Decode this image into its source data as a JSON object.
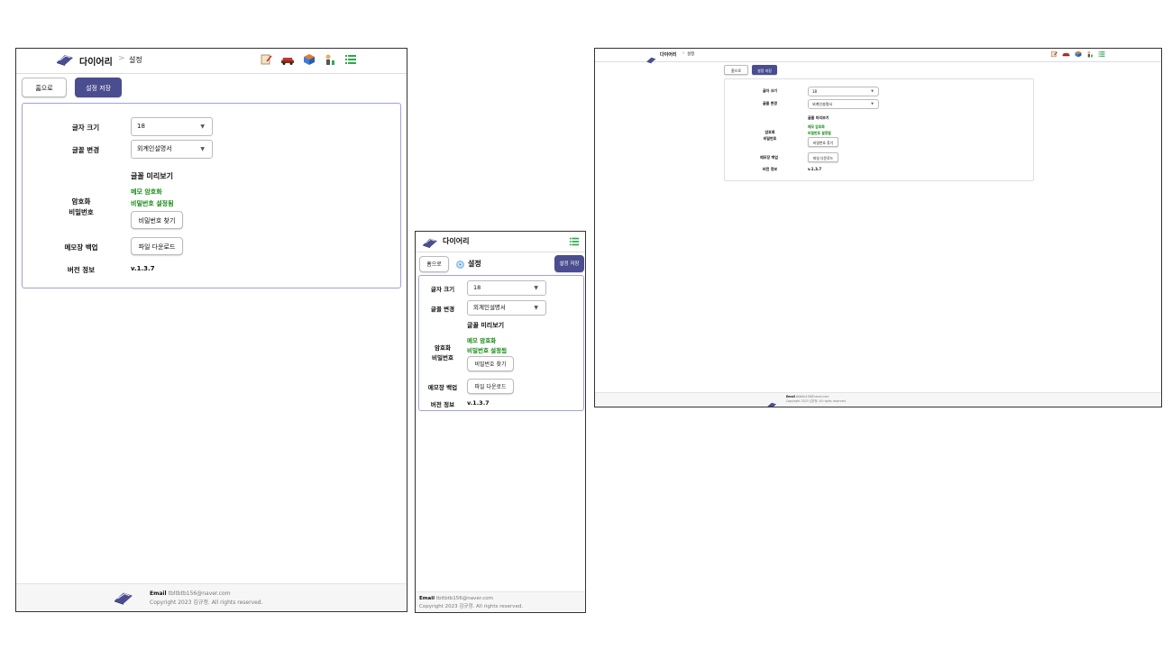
{
  "app": {
    "title": "다이어리",
    "breadcrumb_sep": ">",
    "page": "설정"
  },
  "buttons": {
    "home": "홈으로",
    "save": "설정 저장"
  },
  "settings": {
    "font_size_label": "글자 크기",
    "font_size_value": "18",
    "font_label": "글꼴 변경",
    "font_value": "외계인설명서",
    "font_preview": "글꼴 미리보기",
    "encrypt_label": "암호화\n비밀번호",
    "encrypt_status": "메모 암호화",
    "password_status": "비밀번호 설정됨",
    "find_password": "비밀번호 찾기",
    "backup_label": "메모장 백업",
    "download": "파일 다운로드",
    "version_label": "버전 정보",
    "version_value": "v.1.3.7"
  },
  "footer": {
    "email_label": "Email",
    "email": "tbltbtb156@naver.com",
    "copyright": "Copyright 2023 김규정. All rights reserved."
  },
  "icons": [
    "memo-icon",
    "car-icon",
    "box-icon",
    "person-icon",
    "list-icon"
  ],
  "colors": {
    "primary": "#4a4d8f",
    "green": "#138a13",
    "panel_border": "#9fa3d8"
  }
}
